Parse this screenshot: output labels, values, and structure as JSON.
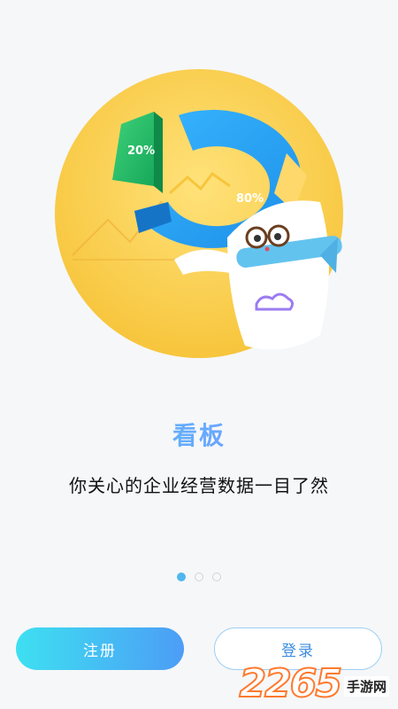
{
  "hero": {
    "chart_left_label": "20%",
    "chart_right_label": "80%"
  },
  "onboarding": {
    "title": "看板",
    "subtitle": "你关心的企业经营数据一目了然"
  },
  "pager": {
    "total": 3,
    "active_index": 0
  },
  "buttons": {
    "register": "注册",
    "login": "登录"
  },
  "watermark": {
    "number": "2265",
    "text": "手游网"
  },
  "colors": {
    "accent": "#4fb7ef",
    "button_gradient_start": "#3ee0f1",
    "button_gradient_end": "#4c9df6",
    "circle_yellow": "#f9cf4a"
  }
}
